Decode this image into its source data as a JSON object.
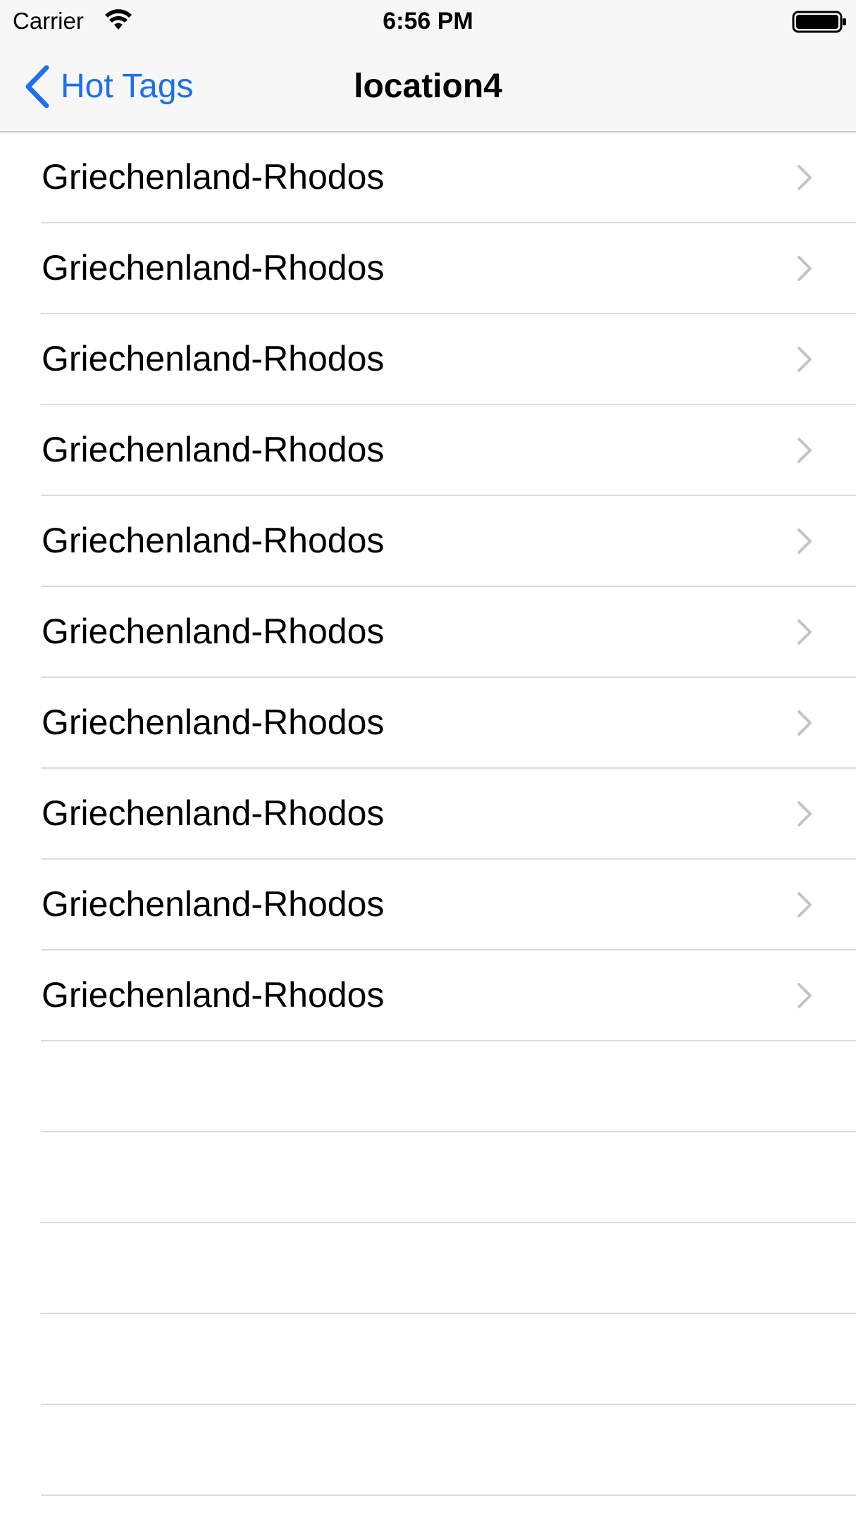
{
  "status_bar": {
    "carrier": "Carrier",
    "time": "6:56 PM",
    "icons": [
      "wifi-icon",
      "battery-icon"
    ]
  },
  "nav_bar": {
    "back_label": "Hot Tags",
    "title": "location4",
    "accent_color": "#1d6fea"
  },
  "list": {
    "items": [
      {
        "label": "Griechenland-Rhodos"
      },
      {
        "label": "Griechenland-Rhodos"
      },
      {
        "label": "Griechenland-Rhodos"
      },
      {
        "label": "Griechenland-Rhodos"
      },
      {
        "label": "Griechenland-Rhodos"
      },
      {
        "label": "Griechenland-Rhodos"
      },
      {
        "label": "Griechenland-Rhodos"
      },
      {
        "label": "Griechenland-Rhodos"
      },
      {
        "label": "Griechenland-Rhodos"
      },
      {
        "label": "Griechenland-Rhodos"
      }
    ]
  }
}
